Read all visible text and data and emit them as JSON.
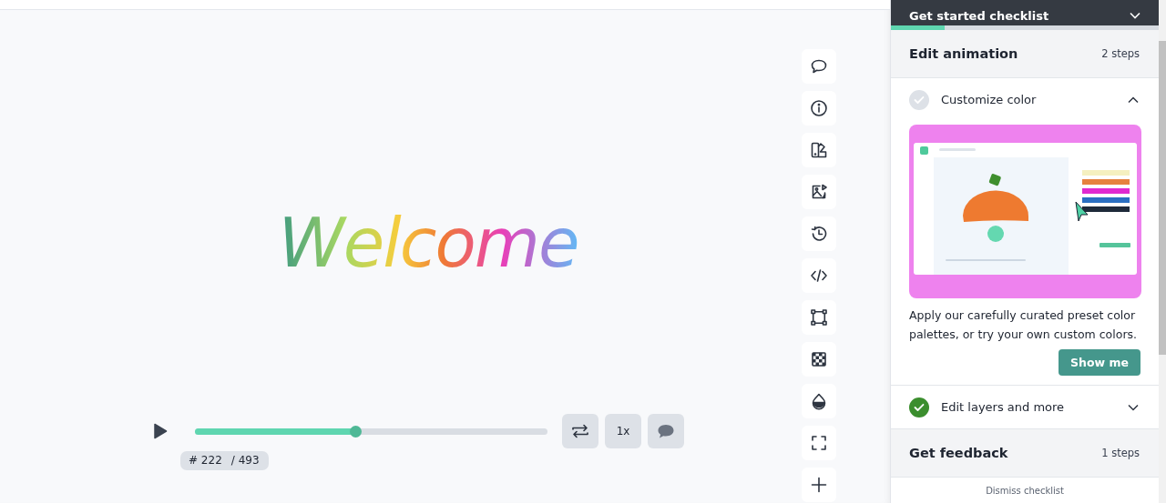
{
  "canvas": {
    "lettering": "Welcome"
  },
  "player": {
    "progress": {
      "level": 0.455
    },
    "frame": "# 222",
    "total": "/ 493",
    "speed": "1x"
  },
  "checklist": {
    "title": "Get started checklist",
    "progress": {
      "level": 0.2
    },
    "sections": [
      {
        "title": "Edit animation",
        "steps_count": "2 steps",
        "steps": [
          {
            "label": "Customize color",
            "checked": false,
            "expanded": true,
            "description": "Apply our carefully curated preset color palettes, or try your own custom colors.",
            "button": "Show me"
          },
          {
            "label": "Edit layers and more",
            "checked": true,
            "expanded": false
          }
        ]
      },
      {
        "title": "Get feedback",
        "steps_count": "1 steps"
      }
    ],
    "dismiss": "Dismiss checklist"
  }
}
